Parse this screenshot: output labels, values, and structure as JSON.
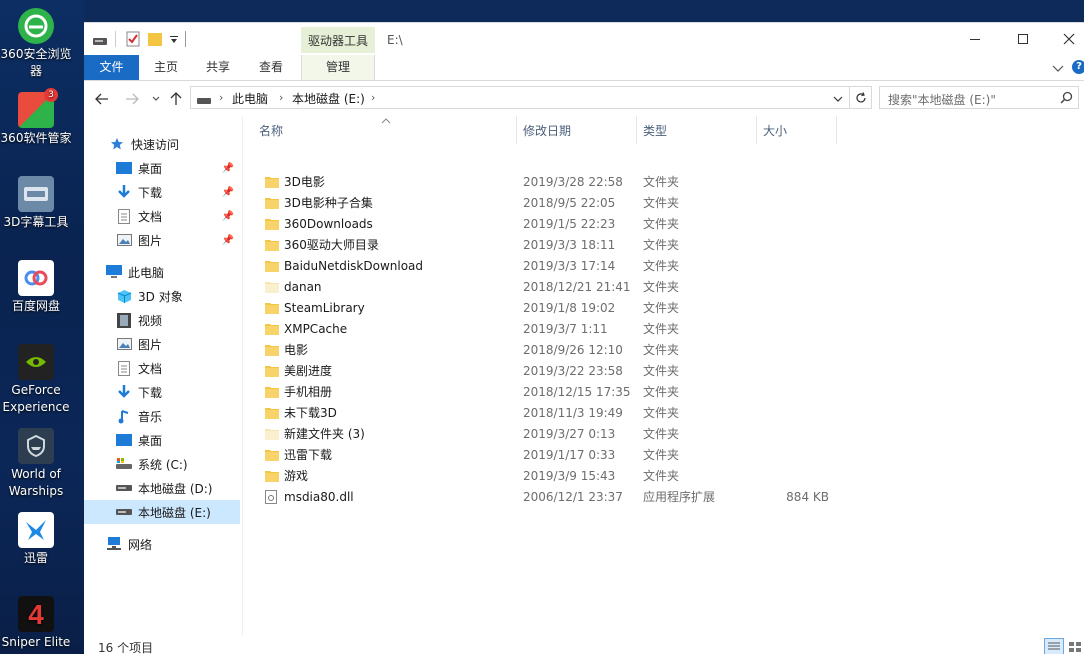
{
  "desktop": {
    "icons": [
      {
        "label": "360安全浏览\n器",
        "color": "#2db34a"
      },
      {
        "label": "360软件管家",
        "color": "#e94b3c",
        "badge": "3"
      },
      {
        "label": "3D字幕工具",
        "color": "#5a7a9a"
      },
      {
        "label": "百度网盘",
        "color": "#4a8ef0"
      },
      {
        "label": "GeForce\nExperience",
        "color": "#2a2a2a"
      },
      {
        "label": "World of\nWarships",
        "color": "#2c3e50"
      },
      {
        "label": "迅雷",
        "color": "#1e88e5"
      },
      {
        "label": "Sniper Elite",
        "color": "#c62828"
      }
    ]
  },
  "titlebar": {
    "tools_tab": "驱动器工具",
    "path": "E:\\"
  },
  "ribbon": {
    "tabs": [
      "文件",
      "主页",
      "共享",
      "查看",
      "管理"
    ]
  },
  "address": {
    "crumbs": [
      "此电脑",
      "本地磁盘 (E:)"
    ],
    "search_placeholder": "搜索\"本地磁盘 (E:)\""
  },
  "navpane": {
    "quick_access": "快速访问",
    "quick_items": [
      "桌面",
      "下载",
      "文档",
      "图片"
    ],
    "this_pc": "此电脑",
    "pc_items": [
      "3D 对象",
      "视频",
      "图片",
      "文档",
      "下载",
      "音乐",
      "桌面",
      "系统 (C:)",
      "本地磁盘 (D:)",
      "本地磁盘 (E:)"
    ],
    "network": "网络"
  },
  "table": {
    "headers": [
      "名称",
      "修改日期",
      "类型",
      "大小"
    ],
    "rows": [
      {
        "name": "3D电影",
        "date": "2019/3/28 22:58",
        "type": "文件夹",
        "size": "",
        "kind": "folder"
      },
      {
        "name": "3D电影种子合集",
        "date": "2018/9/5 22:05",
        "type": "文件夹",
        "size": "",
        "kind": "folder"
      },
      {
        "name": "360Downloads",
        "date": "2019/1/5 22:23",
        "type": "文件夹",
        "size": "",
        "kind": "folder"
      },
      {
        "name": "360驱动大师目录",
        "date": "2019/3/3 18:11",
        "type": "文件夹",
        "size": "",
        "kind": "folder"
      },
      {
        "name": "BaiduNetdiskDownload",
        "date": "2019/3/3 17:14",
        "type": "文件夹",
        "size": "",
        "kind": "folder"
      },
      {
        "name": "danan",
        "date": "2018/12/21 21:41",
        "type": "文件夹",
        "size": "",
        "kind": "folder-empty"
      },
      {
        "name": "SteamLibrary",
        "date": "2019/1/8 19:02",
        "type": "文件夹",
        "size": "",
        "kind": "folder"
      },
      {
        "name": "XMPCache",
        "date": "2019/3/7 1:11",
        "type": "文件夹",
        "size": "",
        "kind": "folder"
      },
      {
        "name": "电影",
        "date": "2018/9/26 12:10",
        "type": "文件夹",
        "size": "",
        "kind": "folder"
      },
      {
        "name": "美剧进度",
        "date": "2019/3/22 23:58",
        "type": "文件夹",
        "size": "",
        "kind": "folder"
      },
      {
        "name": "手机相册",
        "date": "2018/12/15 17:35",
        "type": "文件夹",
        "size": "",
        "kind": "folder"
      },
      {
        "name": "未下载3D",
        "date": "2018/11/3 19:49",
        "type": "文件夹",
        "size": "",
        "kind": "folder"
      },
      {
        "name": "新建文件夹 (3)",
        "date": "2019/3/27 0:13",
        "type": "文件夹",
        "size": "",
        "kind": "folder-empty"
      },
      {
        "name": "迅雷下载",
        "date": "2019/1/17 0:33",
        "type": "文件夹",
        "size": "",
        "kind": "folder"
      },
      {
        "name": "游戏",
        "date": "2019/3/9 15:43",
        "type": "文件夹",
        "size": "",
        "kind": "folder"
      },
      {
        "name": "msdia80.dll",
        "date": "2006/12/1 23:37",
        "type": "应用程序扩展",
        "size": "884 KB",
        "kind": "dll"
      }
    ]
  },
  "status": {
    "count": "16 个项目"
  },
  "colors": {
    "accent": "#1a6bc3",
    "folder": "#f4c542",
    "selected": "#cce8ff"
  }
}
